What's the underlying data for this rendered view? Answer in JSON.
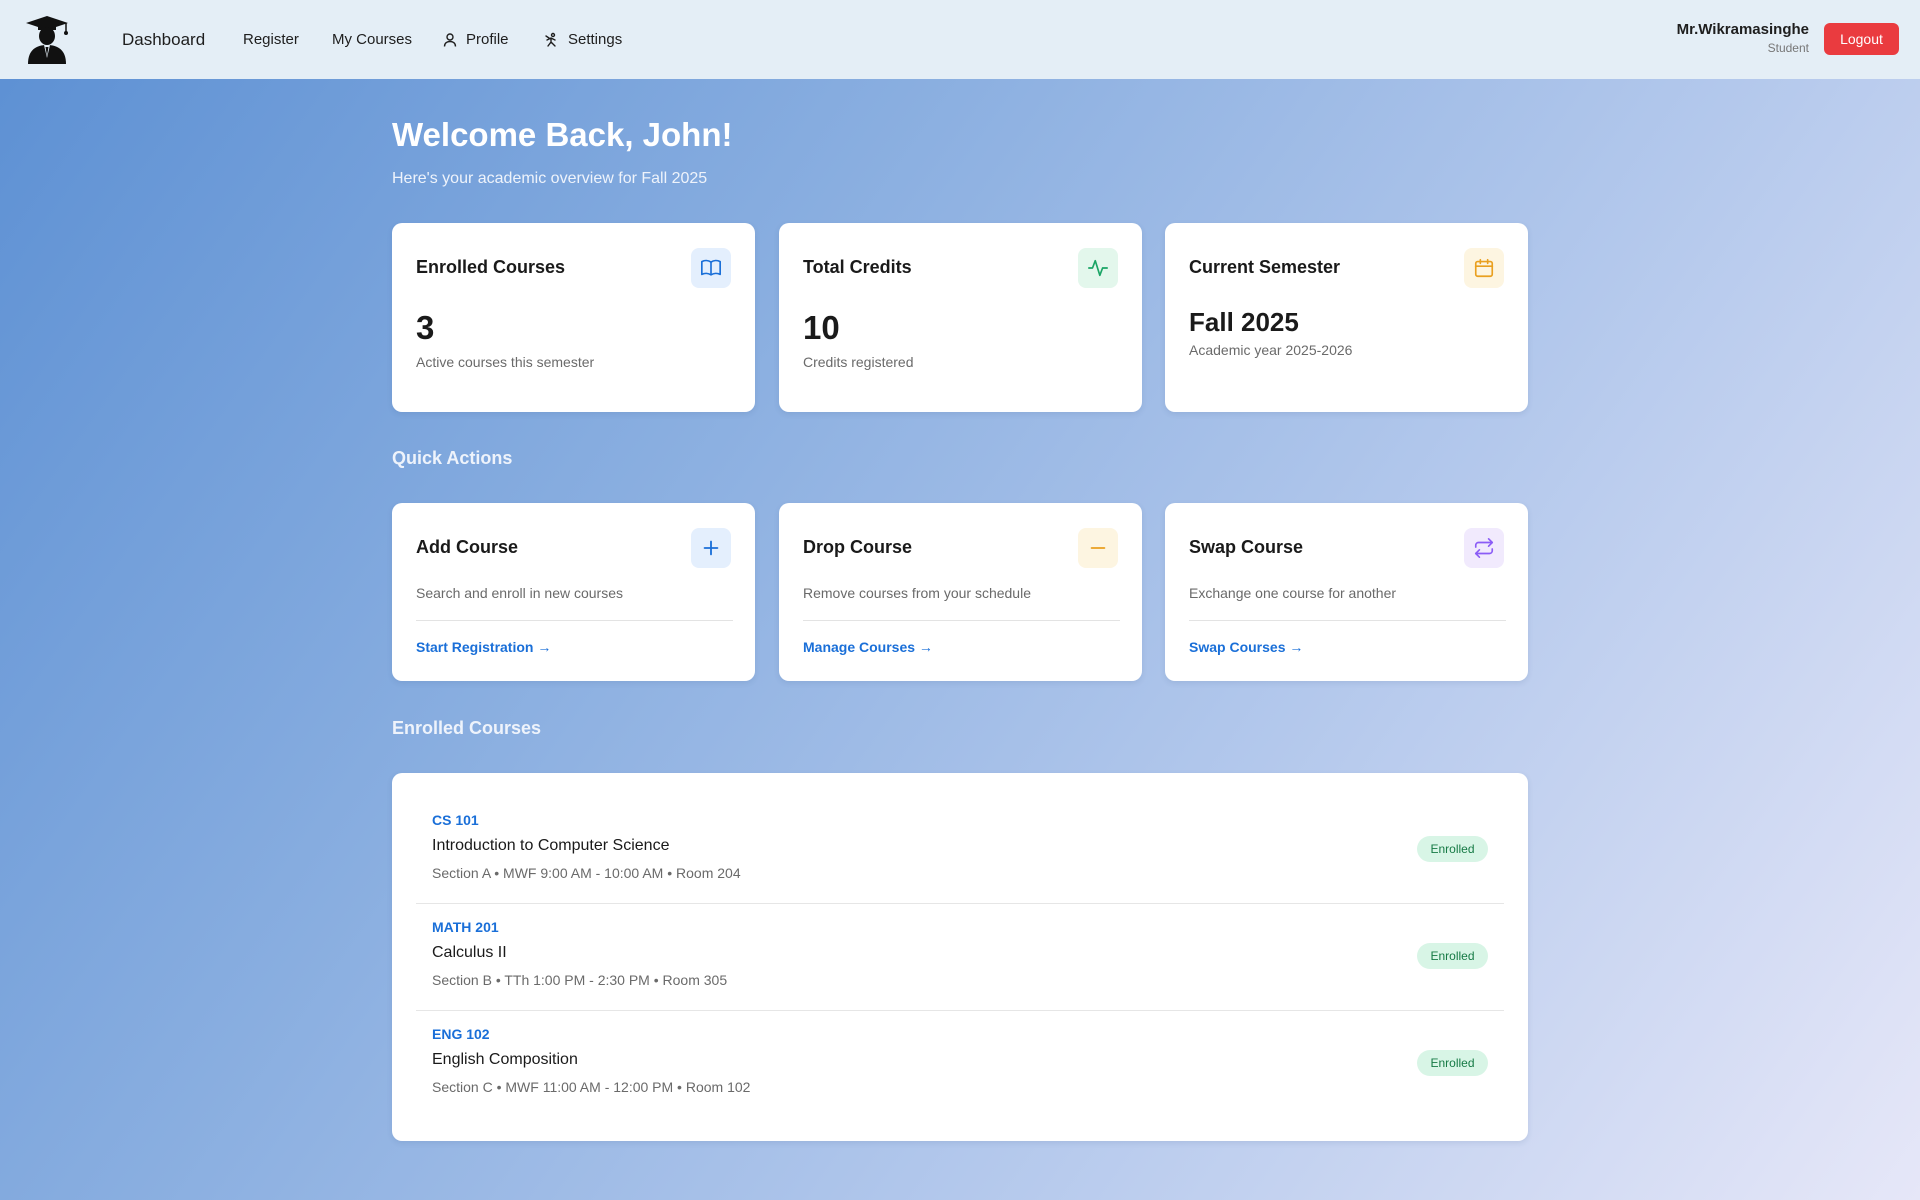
{
  "header": {
    "nav": {
      "dashboard": "Dashboard",
      "register": "Register",
      "my_courses": "My Courses",
      "profile": "Profile",
      "settings": "Settings"
    },
    "user": {
      "name": "Mr.Wikramasinghe",
      "role": "Student"
    },
    "logout_label": "Logout"
  },
  "welcome": {
    "title": "Welcome Back, John!",
    "subtitle": "Here's your academic overview for Fall 2025"
  },
  "stats": [
    {
      "title": "Enrolled Courses",
      "value": "3",
      "caption": "Active courses this semester",
      "icon": "book-icon",
      "color": "#1a6fd8"
    },
    {
      "title": "Total Credits",
      "value": "10",
      "caption": "Credits registered",
      "icon": "activity-icon",
      "color": "#1aa565"
    },
    {
      "title": "Current Semester",
      "value": "Fall 2025",
      "caption": "Academic year 2025-2026",
      "icon": "calendar-icon",
      "color": "#e9a020"
    }
  ],
  "quick_actions": {
    "title": "Quick Actions",
    "items": [
      {
        "title": "Add Course",
        "desc": "Search and enroll in new courses",
        "link": "Start Registration →",
        "icon": "plus-icon",
        "color": "#1a6fd8"
      },
      {
        "title": "Drop Course",
        "desc": "Remove courses from your schedule",
        "link": "Manage Courses →",
        "icon": "minus-icon",
        "color": "#e9a020"
      },
      {
        "title": "Swap Course",
        "desc": "Exchange one course for another",
        "link": "Swap Courses →",
        "icon": "swap-icon",
        "color": "#8b5cf6"
      }
    ]
  },
  "enrolled": {
    "title": "Enrolled Courses",
    "courses": [
      {
        "code": "CS 101",
        "name": "Introduction to Computer Science",
        "meta": "Section A • MWF 9:00 AM - 10:00 AM • Room 204",
        "status": "Enrolled"
      },
      {
        "code": "MATH 201",
        "name": "Calculus II",
        "meta": "Section B • TTh 1:00 PM - 2:30 PM • Room 305",
        "status": "Enrolled"
      },
      {
        "code": "ENG 102",
        "name": "English Composition",
        "meta": "Section C • MWF 11:00 AM - 12:00 PM • Room 102",
        "status": "Enrolled"
      }
    ]
  }
}
